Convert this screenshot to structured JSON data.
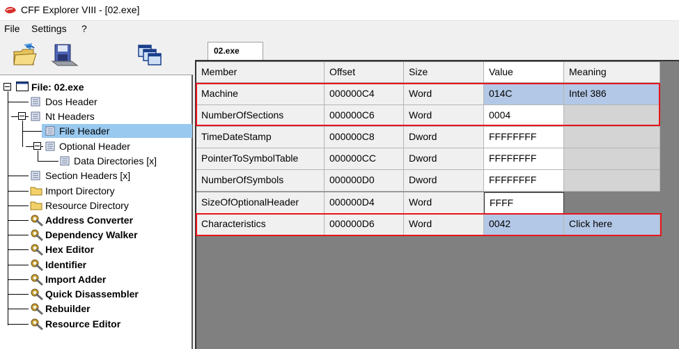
{
  "window": {
    "title": "CFF Explorer VIII - [02.exe]"
  },
  "menu": {
    "file": "File",
    "settings": "Settings",
    "help": "?"
  },
  "tab": {
    "label": "02.exe"
  },
  "tree": {
    "root": "File: 02.exe",
    "dos_header": "Dos Header",
    "nt_headers": "Nt Headers",
    "file_header": "File Header",
    "optional_header": "Optional Header",
    "data_directories": "Data Directories [x]",
    "section_headers": "Section Headers [x]",
    "import_directory": "Import Directory",
    "resource_directory": "Resource Directory",
    "address_converter": "Address Converter",
    "dependency_walker": "Dependency Walker",
    "hex_editor": "Hex Editor",
    "identifier": "Identifier",
    "import_adder": "Import Adder",
    "quick_disassembler": "Quick Disassembler",
    "rebuilder": "Rebuilder",
    "resource_editor": "Resource Editor"
  },
  "grid": {
    "headers": {
      "member": "Member",
      "offset": "Offset",
      "size": "Size",
      "value": "Value",
      "meaning": "Meaning"
    },
    "rows": [
      {
        "member": "Machine",
        "offset": "000000C4",
        "size": "Word",
        "value": "014C",
        "meaning": "Intel 386"
      },
      {
        "member": "NumberOfSections",
        "offset": "000000C6",
        "size": "Word",
        "value": "0004",
        "meaning": ""
      },
      {
        "member": "TimeDateStamp",
        "offset": "000000C8",
        "size": "Dword",
        "value": "FFFFFFFF",
        "meaning": ""
      },
      {
        "member": "PointerToSymbolTable",
        "offset": "000000CC",
        "size": "Dword",
        "value": "FFFFFFFF",
        "meaning": ""
      },
      {
        "member": "NumberOfSymbols",
        "offset": "000000D0",
        "size": "Dword",
        "value": "FFFFFFFF",
        "meaning": ""
      },
      {
        "member": "SizeOfOptionalHeader",
        "offset": "000000D4",
        "size": "Word",
        "value": "FFFF",
        "meaning": ""
      },
      {
        "member": "Characteristics",
        "offset": "000000D6",
        "size": "Word",
        "value": "0042",
        "meaning": "Click here"
      }
    ]
  },
  "colors": {
    "highlight": "#b3c8e6",
    "selection": "#99c9ef",
    "annotation_red": "#e8141c"
  }
}
